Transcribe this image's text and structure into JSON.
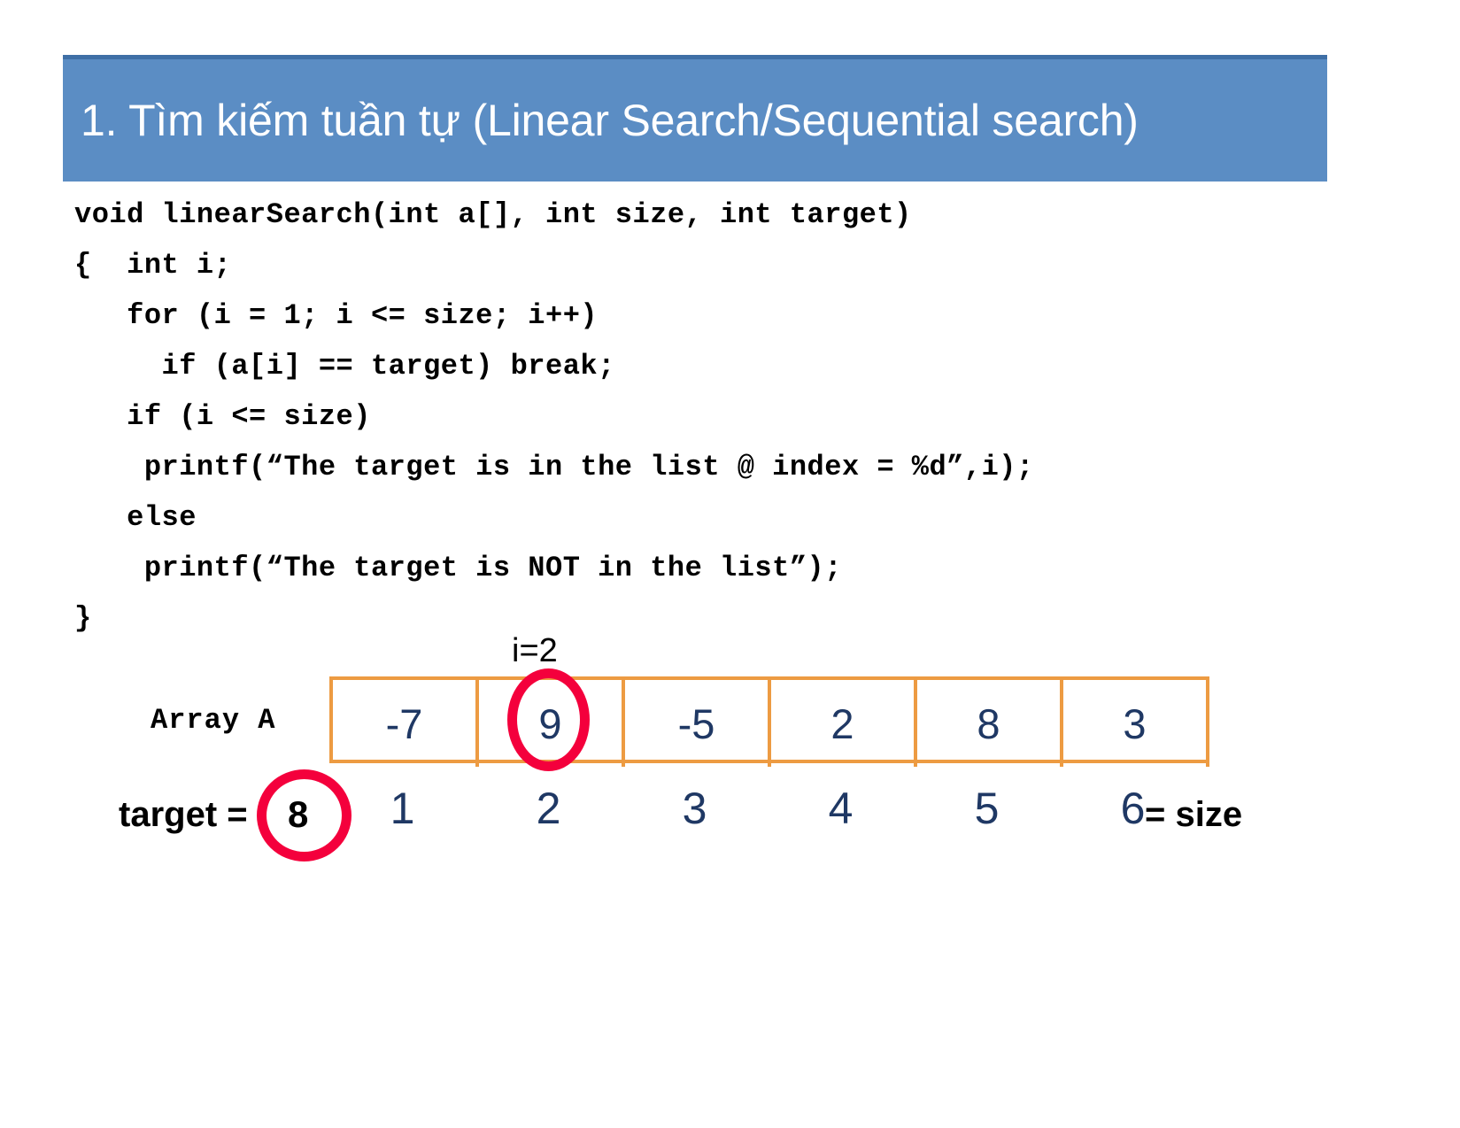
{
  "slide": {
    "title": "1. Tìm kiếm tuần tự (Linear Search/Sequential search)",
    "title_bar_color": "#5B8DC4",
    "title_text_color": "#FFFFFF"
  },
  "code": {
    "language": "c",
    "lines": [
      "void linearSearch(int a[], int size, int target)",
      "{  int i;",
      "   for (i = 1; i <= size; i++)",
      "     if (a[i] == target) break;",
      "   if (i <= size)",
      "    printf(“The target is in the list @ index = %d”,i);",
      "   else",
      "    printf(“The target is NOT in the list”);",
      "}"
    ]
  },
  "diagram": {
    "array_label": "Array A",
    "pointer_label": "i=2",
    "pointer_index": 2,
    "cells": [
      "-7",
      "9",
      "-5",
      "2",
      "8",
      "3"
    ],
    "indices": [
      "1",
      "2",
      "3",
      "4",
      "5",
      "6"
    ],
    "size_label": "= size",
    "target_label": "target =",
    "target_value": "8",
    "highlighted_cell_index": 2,
    "cell_border_color": "#ED9B42",
    "cell_value_color": "#1F3864",
    "highlight_color": "#F4003C"
  }
}
